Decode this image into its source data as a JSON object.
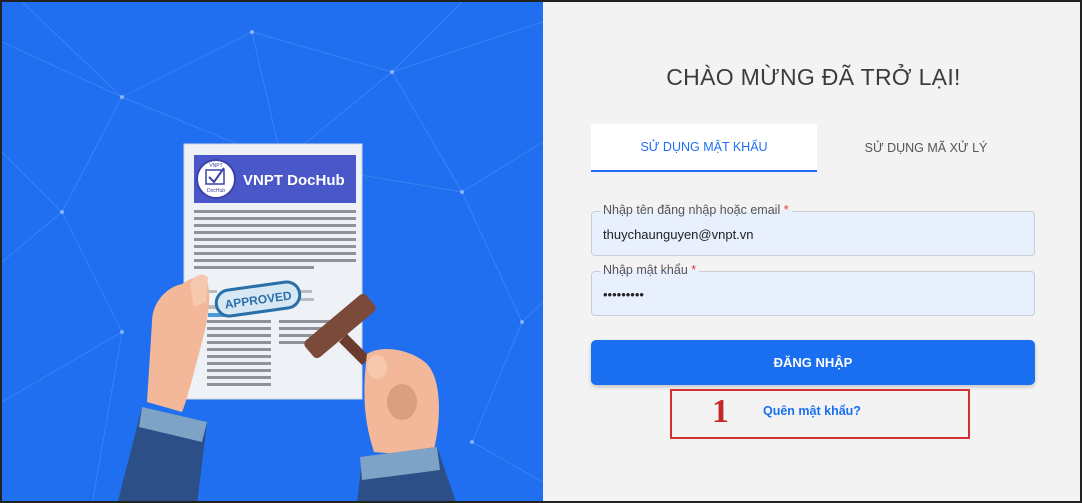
{
  "brand": {
    "name": "VNPT DocHub",
    "logo_small_text": "VNPT",
    "logo_sub_text": "DocHub"
  },
  "stamp_text": "APPROVED",
  "welcome_title": "CHÀO MỪNG ĐÃ TRỞ LẠI!",
  "tabs": [
    {
      "label": "SỬ DỤNG MẬT KHẨU",
      "active": true
    },
    {
      "label": "SỬ DỤNG MÃ XỬ LÝ",
      "active": false
    }
  ],
  "username": {
    "label": "Nhập tên đăng nhập hoặc email",
    "required_mark": "*",
    "value": "thuychaunguyen@vnpt.vn"
  },
  "password": {
    "label": "Nhập mật khẩu",
    "required_mark": "*",
    "value": "•••••••••"
  },
  "login_button": "ĐĂNG NHẬP",
  "forgot_link": "Quên mật khẩu?",
  "annotation_number": "1",
  "colors": {
    "blue": "#1f6ff0",
    "accent_red": "#d32f2f",
    "panel": "#f3f3f4",
    "field": "#e8f0fe"
  }
}
